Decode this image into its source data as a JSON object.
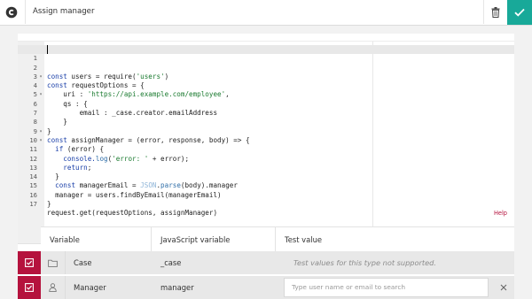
{
  "header": {
    "title_value": "Assign manager",
    "logo_icon": "app-logo-icon",
    "delete_icon": "trash-icon",
    "confirm_icon": "check-icon",
    "accent_color": "#18a999"
  },
  "editor": {
    "lines": [
      {
        "n": "1",
        "fold": ""
      },
      {
        "n": "2",
        "fold": "▾"
      },
      {
        "n": "3",
        "fold": ""
      },
      {
        "n": "4",
        "fold": "▾"
      },
      {
        "n": "5",
        "fold": ""
      },
      {
        "n": "6",
        "fold": ""
      },
      {
        "n": "7",
        "fold": ""
      },
      {
        "n": "8",
        "fold": "▾"
      },
      {
        "n": "9",
        "fold": "▾"
      },
      {
        "n": "10",
        "fold": ""
      },
      {
        "n": "11",
        "fold": ""
      },
      {
        "n": "12",
        "fold": ""
      },
      {
        "n": "13",
        "fold": ""
      },
      {
        "n": "14",
        "fold": ""
      },
      {
        "n": "15",
        "fold": ""
      },
      {
        "n": "16",
        "fold": ""
      },
      {
        "n": "17",
        "fold": ""
      }
    ],
    "code": {
      "l1": [
        "const",
        " users = require(",
        "'users'",
        ")"
      ],
      "l2": [
        "const",
        " requestOptions = {"
      ],
      "l3": [
        "    uri : ",
        "'https://api.example.com/employee'",
        ","
      ],
      "l4": [
        "    qs : {"
      ],
      "l5": [
        "        email : _case.creator.emailAddress"
      ],
      "l6": [
        "    }"
      ],
      "l7": [
        "}"
      ],
      "l8": [
        "const",
        " assignManager = (error, response, body) => {"
      ],
      "l9": [
        "  ",
        "if",
        " (error) {"
      ],
      "l10": [
        "    console.",
        "log",
        "(",
        "'error: '",
        " + error);"
      ],
      "l11": [
        "    ",
        "return",
        ";"
      ],
      "l12": [
        "  }"
      ],
      "l13": [
        "  ",
        "const",
        " managerEmail = ",
        "JSON",
        ".",
        "parse",
        "(body).manager"
      ],
      "l14": [
        "  manager = users.findByEmail(managerEmail)"
      ],
      "l15": [
        "}"
      ],
      "l16": [
        "request.get(requestOptions, assignManager)"
      ],
      "l17": [
        ""
      ]
    },
    "help_label": "Help"
  },
  "table": {
    "headers": [
      "Variable",
      "JavaScript variable",
      "Test value"
    ],
    "rows": [
      {
        "checked": true,
        "type_icon": "folder-icon",
        "variable": "Case",
        "js_variable": "_case",
        "test_value": "Test values for this type not supported."
      },
      {
        "checked": true,
        "type_icon": "user-icon",
        "variable": "Manager",
        "js_variable": "manager",
        "test_placeholder": "Type user name or email to search",
        "clear_icon": "close-icon"
      }
    ],
    "check_color": "#b5123d"
  }
}
